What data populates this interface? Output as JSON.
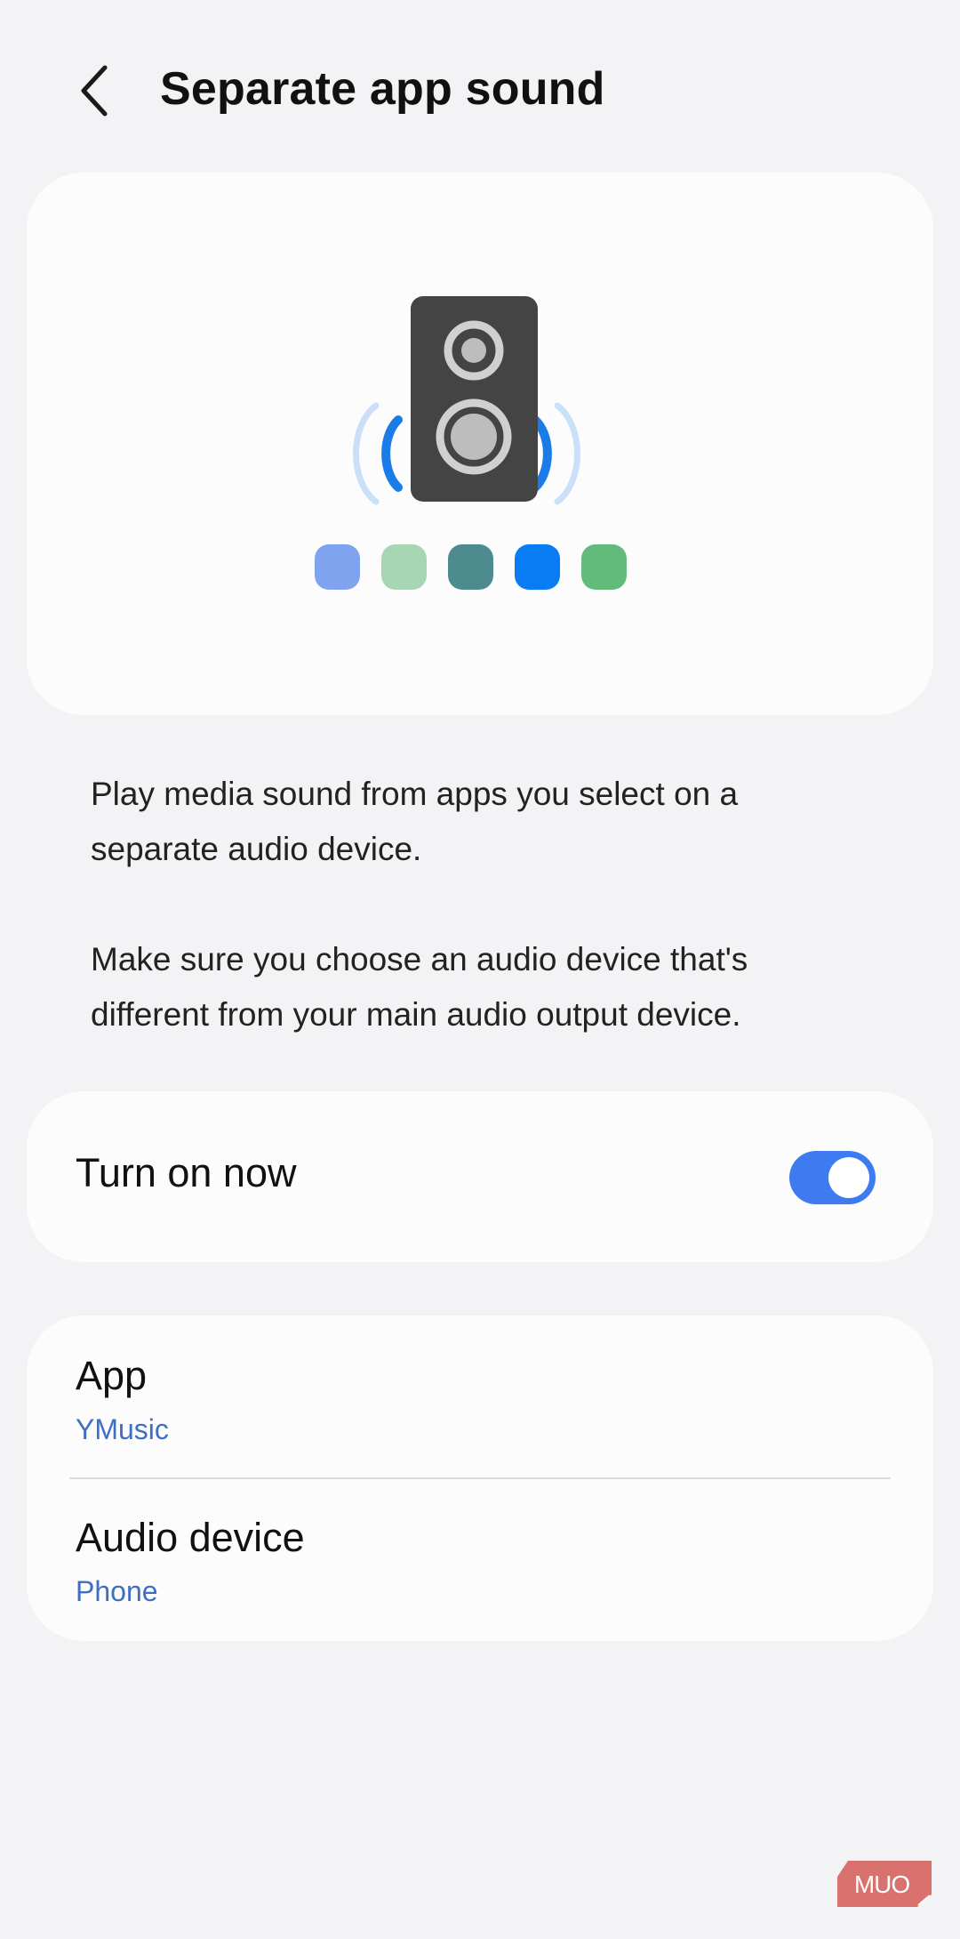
{
  "header": {
    "back_icon": "chevron-left-icon",
    "title": "Separate app sound"
  },
  "hero": {
    "illustration": "speaker-icon",
    "app_dot_colors": [
      "#7fa3ef",
      "#a8d6b4",
      "#4e8b8f",
      "#0a7cf3",
      "#62bb7a"
    ]
  },
  "description": {
    "paragraph_1": "Play media sound from apps you select on a separate audio device.",
    "paragraph_2": "Make sure you choose an audio device that's different from your main audio output device."
  },
  "toggle": {
    "label": "Turn on now",
    "checked": true,
    "accent_color": "#3e7bf0"
  },
  "settings": {
    "app": {
      "title": "App",
      "value": "YMusic"
    },
    "audio_device": {
      "title": "Audio device",
      "value": "Phone"
    }
  },
  "watermark": {
    "text": "MUO"
  }
}
